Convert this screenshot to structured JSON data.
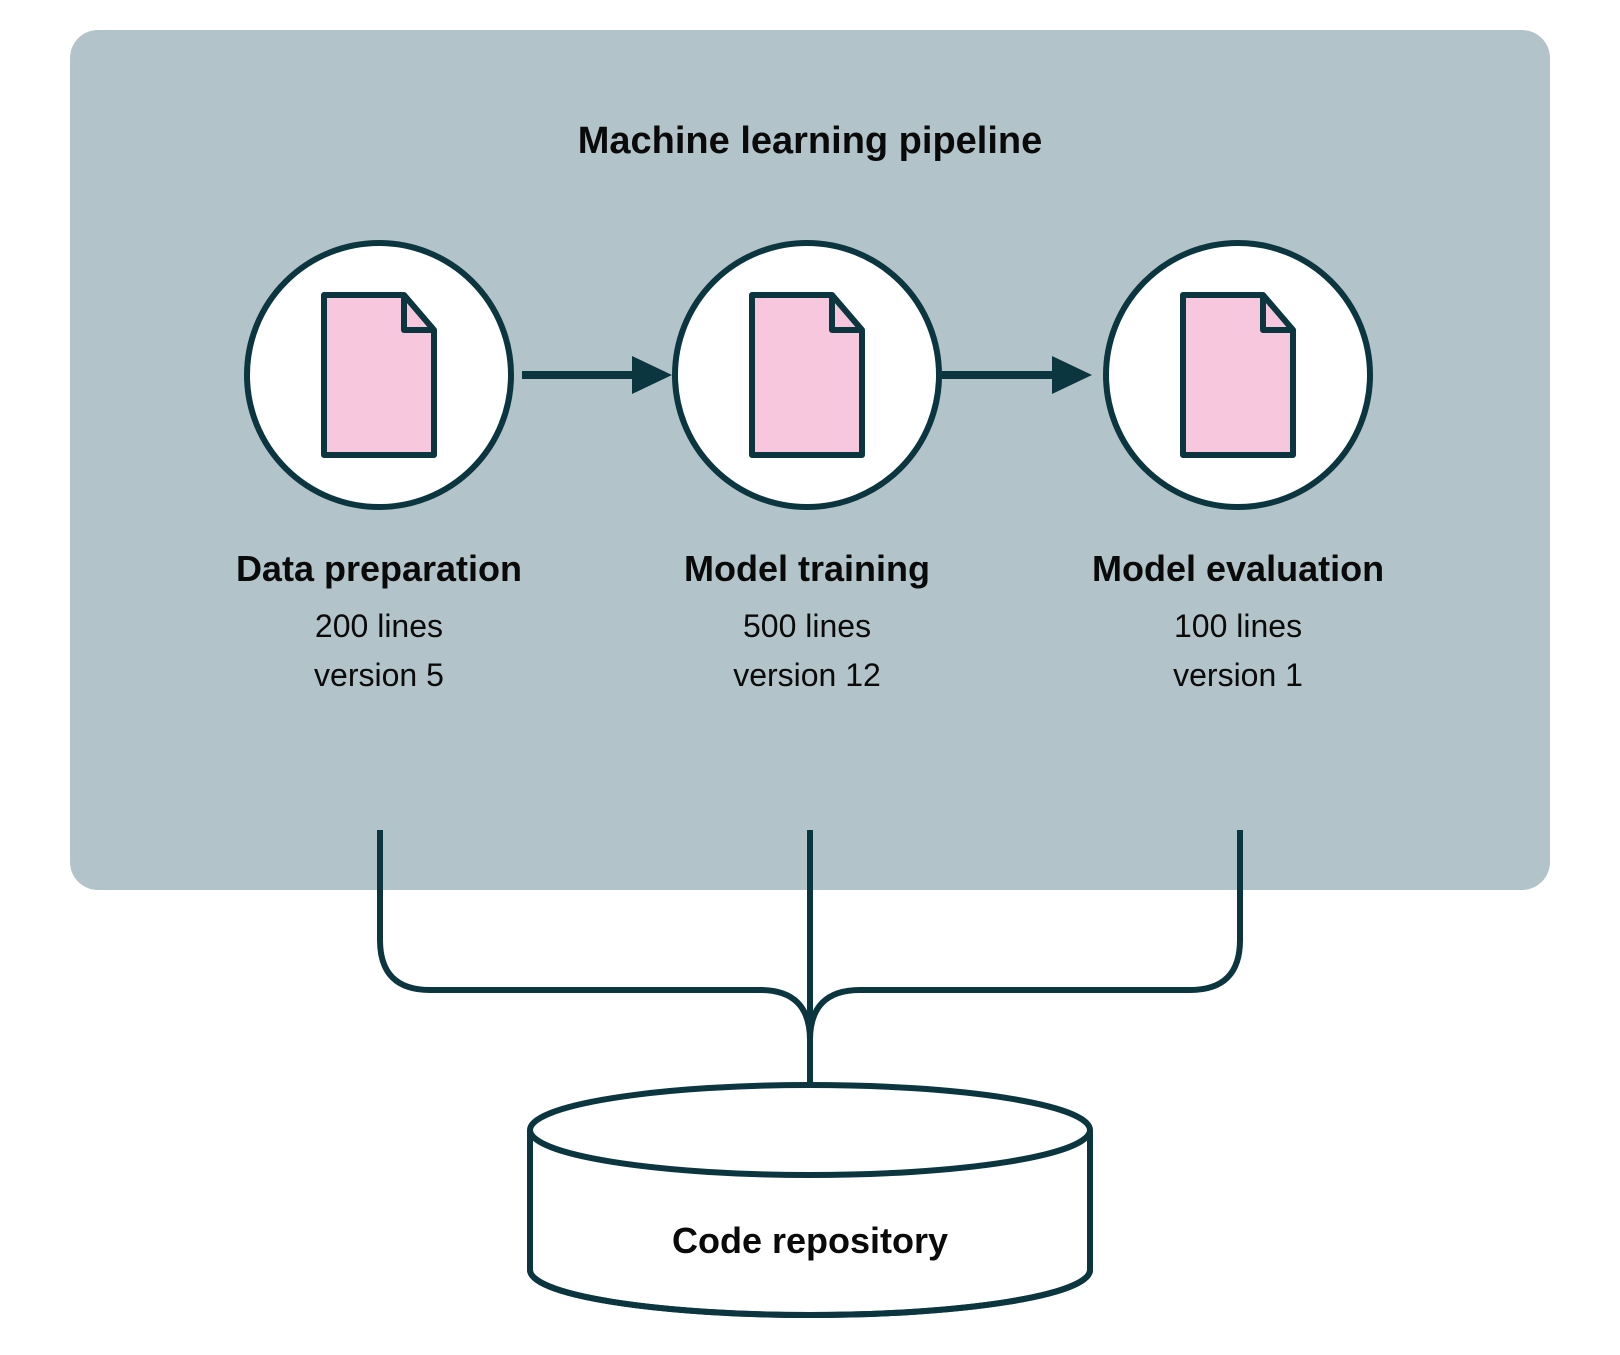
{
  "pipeline": {
    "title": "Machine learning pipeline",
    "stages": [
      {
        "name": "Data preparation",
        "lines": "200 lines",
        "version": "version 5"
      },
      {
        "name": "Model training",
        "lines": "500 lines",
        "version": "version 12"
      },
      {
        "name": "Model evaluation",
        "lines": "100 lines",
        "version": "version 1"
      }
    ]
  },
  "repository": {
    "label": "Code repository"
  },
  "colors": {
    "panel_bg": "#b2c4c9",
    "stroke": "#0b3640",
    "doc_fill": "#f7c8dd"
  }
}
